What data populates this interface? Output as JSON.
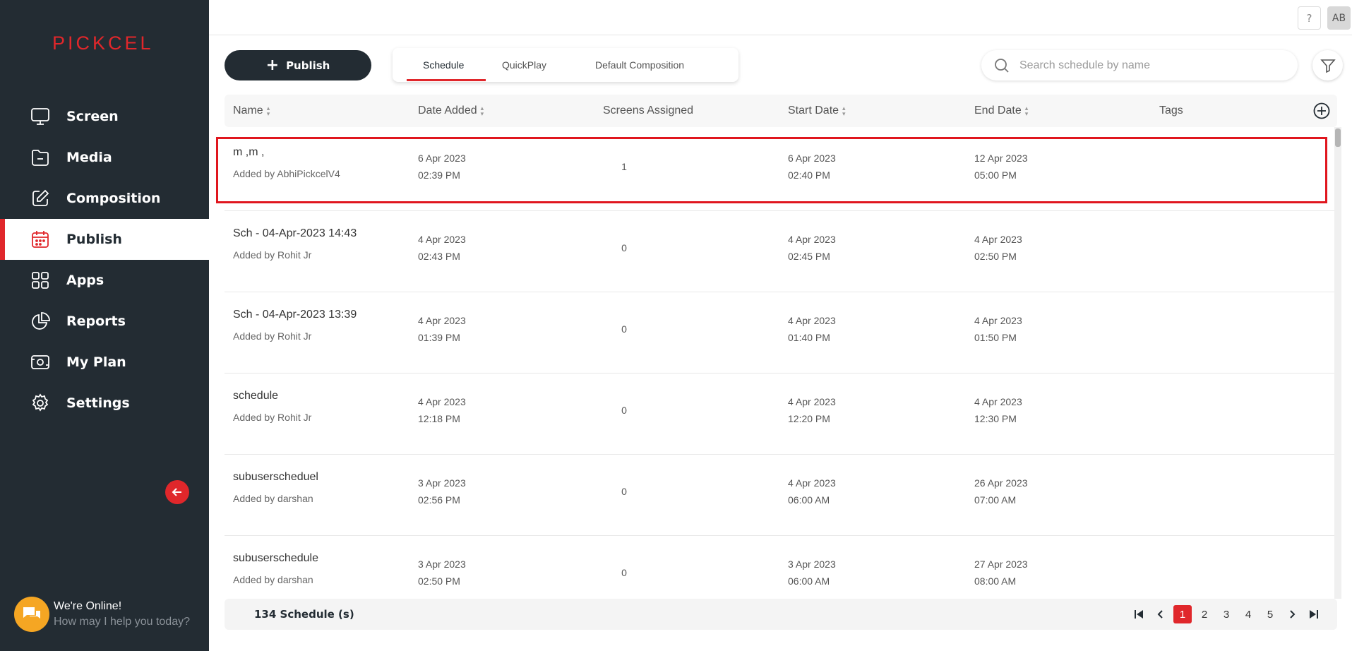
{
  "app": {
    "logo": "PICKCEL",
    "accent": "#e0272b",
    "sidebar_bg": "#232c33"
  },
  "sidebar": {
    "items": [
      {
        "label": "Screen",
        "icon": "monitor-icon"
      },
      {
        "label": "Media",
        "icon": "folder-icon"
      },
      {
        "label": "Composition",
        "icon": "edit-icon"
      },
      {
        "label": "Publish",
        "icon": "calendar-icon",
        "active": true
      },
      {
        "label": "Apps",
        "icon": "apps-grid-icon"
      },
      {
        "label": "Reports",
        "icon": "pie-chart-icon"
      },
      {
        "label": "My Plan",
        "icon": "plan-icon"
      },
      {
        "label": "Settings",
        "icon": "gear-icon"
      }
    ]
  },
  "chat": {
    "title": "We're Online!",
    "subtitle": "How may I help you today?"
  },
  "topbar": {
    "help": "?",
    "avatar": "AB"
  },
  "toolbar": {
    "publish_label": "Publish",
    "tabs": [
      "Schedule",
      "QuickPlay",
      "Default Composition"
    ],
    "active_tab": "Schedule",
    "search_placeholder": "Search schedule by name"
  },
  "table": {
    "columns": [
      "Name",
      "Date Added",
      "Screens Assigned",
      "Start Date",
      "End Date",
      "Tags"
    ],
    "rows": [
      {
        "name": "m ,m ,",
        "added_by": "Added by AbhiPickcelV4",
        "date_added": "6 Apr 2023",
        "time_added": "02:39 PM",
        "screens": "1",
        "start_date": "6 Apr 2023",
        "start_time": "02:40 PM",
        "end_date": "12 Apr 2023",
        "end_time": "05:00 PM"
      },
      {
        "name": "Sch - 04-Apr-2023 14:43",
        "added_by": "Added by Rohit Jr",
        "date_added": "4 Apr 2023",
        "time_added": "02:43 PM",
        "screens": "0",
        "start_date": "4 Apr 2023",
        "start_time": "02:45 PM",
        "end_date": "4 Apr 2023",
        "end_time": "02:50 PM"
      },
      {
        "name": "Sch - 04-Apr-2023 13:39",
        "added_by": "Added by Rohit Jr",
        "date_added": "4 Apr 2023",
        "time_added": "01:39 PM",
        "screens": "0",
        "start_date": "4 Apr 2023",
        "start_time": "01:40 PM",
        "end_date": "4 Apr 2023",
        "end_time": "01:50 PM"
      },
      {
        "name": "schedule",
        "added_by": "Added by Rohit Jr",
        "date_added": "4 Apr 2023",
        "time_added": "12:18 PM",
        "screens": "0",
        "start_date": "4 Apr 2023",
        "start_time": "12:20 PM",
        "end_date": "4 Apr 2023",
        "end_time": "12:30 PM"
      },
      {
        "name": "subuserscheduel",
        "added_by": "Added by darshan",
        "date_added": "3 Apr 2023",
        "time_added": "02:56 PM",
        "screens": "0",
        "start_date": "4 Apr 2023",
        "start_time": "06:00 AM",
        "end_date": "26 Apr 2023",
        "end_time": "07:00 AM"
      },
      {
        "name": "subuserschedule",
        "added_by": "Added by darshan",
        "date_added": "3 Apr 2023",
        "time_added": "02:50 PM",
        "screens": "0",
        "start_date": "3 Apr 2023",
        "start_time": "06:00 AM",
        "end_date": "27 Apr 2023",
        "end_time": "08:00 AM"
      }
    ]
  },
  "footer": {
    "count_label": "134 Schedule (s)",
    "pages": [
      "1",
      "2",
      "3",
      "4",
      "5"
    ],
    "current_page": "1"
  }
}
